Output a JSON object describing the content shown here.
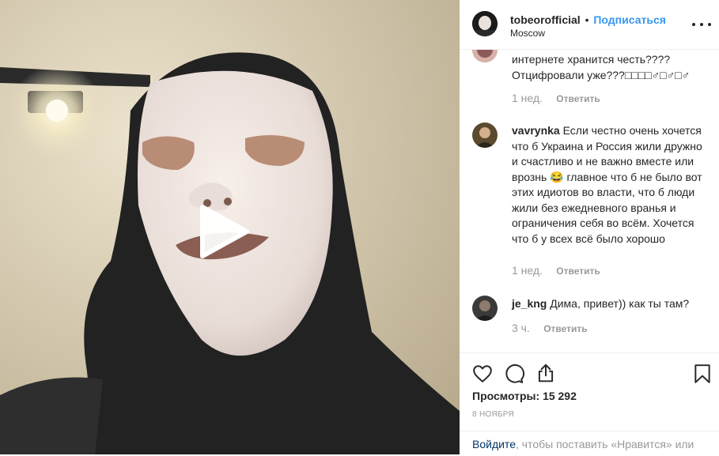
{
  "post": {
    "username": "tobeorofficial",
    "dot": "•",
    "follow_label": "Подписаться",
    "location": "Moscow"
  },
  "comments": [
    {
      "username": "",
      "text": "интернете хранится честь???? Отцифровали уже???□□□□♂□♂□♂",
      "age": "1 нед.",
      "reply_label": "Ответить"
    },
    {
      "username": "vavrynka",
      "text": "Если честно очень хочется что б Украина и Россия жили дружно и счастливо и не важно вместе или врознь 😂 главное что б не было вот этих идиотов во власти, что б люди жили без ежедневного вранья и ограничения себя во всём. Хочется что б у всех всё было хорошо",
      "age": "1 нед.",
      "reply_label": "Ответить"
    },
    {
      "username": "je_kng",
      "text": "Дима, привет)) как ты там?",
      "age": "3 ч.",
      "reply_label": "Ответить"
    }
  ],
  "stats": {
    "views_label": "Просмотры:",
    "views_count": "15 292",
    "date": "8 ноября"
  },
  "login_prompt": {
    "link": "Войдите",
    "text": ", чтобы поставить «Нравится» или"
  },
  "icons": {
    "like": "heart-icon",
    "comment": "comment-icon",
    "share": "share-icon",
    "save": "bookmark-icon",
    "play": "play-icon",
    "more": "more-options-icon"
  },
  "colors": {
    "link_blue": "#3897f0",
    "muted_gray": "#999999",
    "dark_link": "#003569"
  }
}
